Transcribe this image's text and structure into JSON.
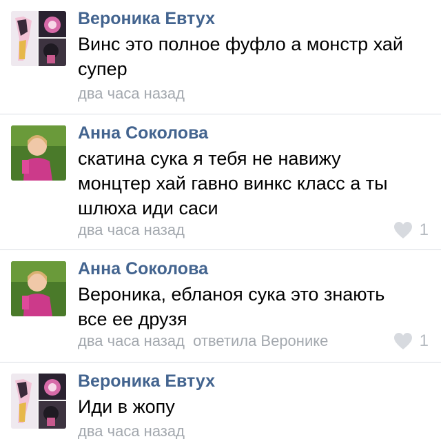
{
  "comments": [
    {
      "author": "Вероника Евтух",
      "lines": [
        "Винс это полное фуфло а монстр хай",
        "супер"
      ],
      "time": "два часа назад",
      "reply_to": "",
      "likes": ""
    },
    {
      "author": "Анна Соколова",
      "lines": [
        "скатина сука я тебя не навижу",
        "монцтер хай гавно винкс класс а ты",
        "шлюха иди саси"
      ],
      "time": "два часа назад",
      "reply_to": "",
      "likes": "1"
    },
    {
      "author": "Анна Соколова",
      "lines": [
        "Вероника, ебланоя сука это знають",
        "все ее друзя"
      ],
      "time": "два часа назад",
      "reply_to": "ответила Веронике",
      "likes": "1"
    },
    {
      "author": "Вероника Евтух",
      "lines": [
        "Иди в жопу"
      ],
      "time": "два часа назад",
      "reply_to": "",
      "likes": ""
    }
  ],
  "colors": {
    "author": "#43648f",
    "meta": "#a3a8ae",
    "divider": "#d9dde3",
    "like": "#b5bac0"
  },
  "icons": {
    "like": "heart-icon"
  }
}
